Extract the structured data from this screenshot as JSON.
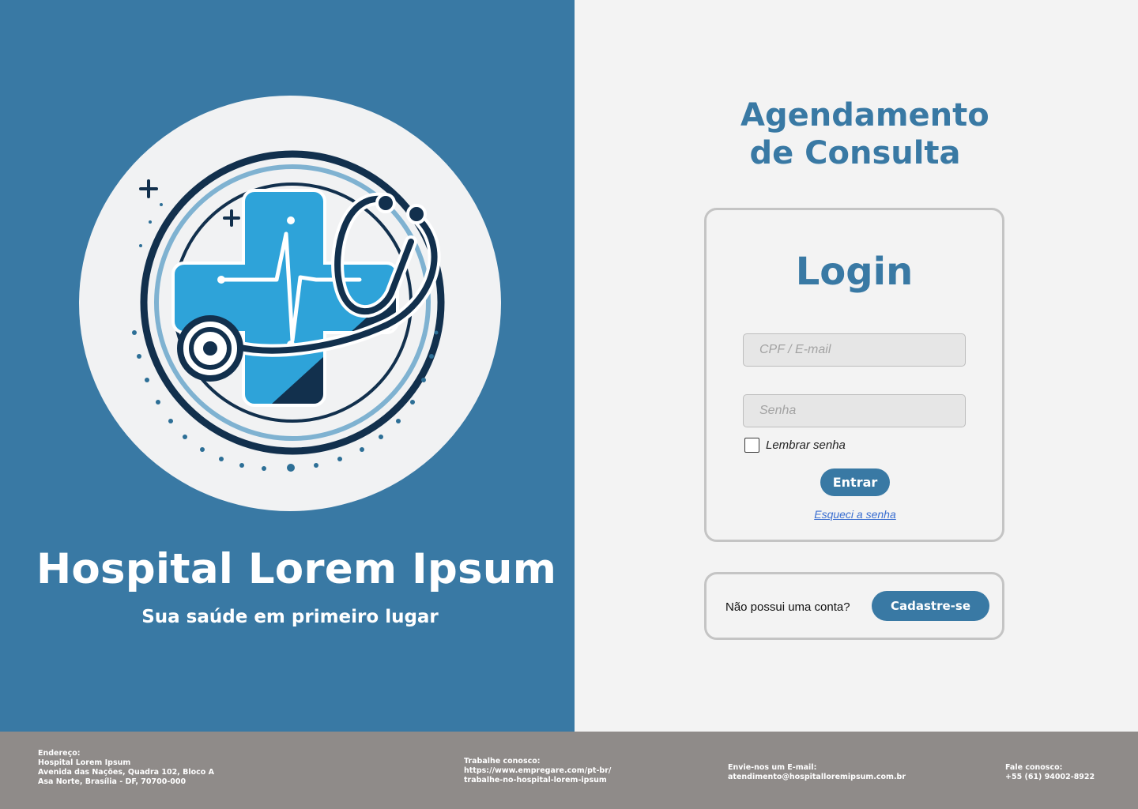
{
  "brand": {
    "hospital_name": "Hospital Lorem Ipsum",
    "slogan": "Sua saúde em primeiro lugar",
    "logo_icon": "medical-cross-stethoscope-logo",
    "primary_color": "#3979a4"
  },
  "page": {
    "title_line1": "Agendamento",
    "title_line2": "de Consulta"
  },
  "login": {
    "title": "Login",
    "cpf_placeholder": "CPF / E-mail",
    "password_placeholder": "Senha",
    "remember_label": "Lembrar senha",
    "remember_checked": false,
    "enter_label": "Entrar",
    "forgot_label": "Esqueci a senha"
  },
  "signup": {
    "prompt": "Não possui uma conta?",
    "button_label": "Cadastre-se"
  },
  "footer": {
    "address": {
      "label": "Endereço:",
      "line1": "Hospital Lorem Ipsum",
      "line2": "Avenida das Nações, Quadra 102, Bloco A",
      "line3": "Asa Norte, Brasília - DF, 70700-000"
    },
    "work": {
      "label": "Trabalhe conosco:",
      "line1": "https://www.empregare.com/pt-br/",
      "line2": "trabalhe-no-hospital-lorem-ipsum"
    },
    "email": {
      "label": "Envie-nos um E-mail:",
      "value": "atendimento@hospitalloremipsum.com.br"
    },
    "phone": {
      "label": "Fale conosco:",
      "value": "+55 (61) 94002-8922"
    }
  }
}
